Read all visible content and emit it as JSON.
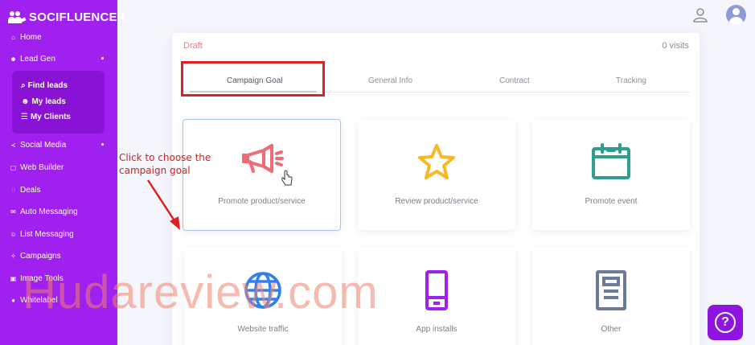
{
  "brand": {
    "name": "SOCIFLUENCER"
  },
  "sidebar": {
    "items": [
      {
        "label": "Home",
        "icon": "home-icon"
      },
      {
        "label": "Lead Gen",
        "icon": "users-icon"
      },
      {
        "label": "Social Media",
        "icon": "share-icon"
      },
      {
        "label": "Web Builder",
        "icon": "window-icon"
      },
      {
        "label": "Deals",
        "icon": "tag-icon"
      },
      {
        "label": "Auto Messaging",
        "icon": "mail-icon"
      },
      {
        "label": "List Messaging",
        "icon": "people-icon"
      },
      {
        "label": "Campaigns",
        "icon": "campaign-icon"
      },
      {
        "label": "Image Tools",
        "icon": "image-icon"
      },
      {
        "label": "Whitelabel",
        "icon": "whitelabel-icon"
      }
    ],
    "submenu": [
      {
        "label": "Find leads",
        "icon": "search-icon"
      },
      {
        "label": "My leads",
        "icon": "users-icon"
      },
      {
        "label": "My Clients",
        "icon": "list-icon"
      }
    ]
  },
  "campaign": {
    "status": "Draft",
    "visits": "0 visits",
    "tabs": [
      "Campaign Goal",
      "General Info",
      "Contract",
      "Tracking"
    ],
    "goals": [
      {
        "label": "Promote product/service",
        "icon": "megaphone-icon",
        "color": "#f36a73"
      },
      {
        "label": "Review product/service",
        "icon": "star-icon",
        "color": "#f7b928"
      },
      {
        "label": "Promote event",
        "icon": "calendar-icon",
        "color": "#2f9e8f"
      },
      {
        "label": "Website traffic",
        "icon": "globe-icon",
        "color": "#2f80ed"
      },
      {
        "label": "App installs",
        "icon": "phone-icon",
        "color": "#a020f0"
      },
      {
        "label": "Other",
        "icon": "document-icon",
        "color": "#6b7a99"
      }
    ]
  },
  "annotation": {
    "note_line1": "Click to choose the",
    "note_line2": "campaign goal"
  },
  "watermark": "Hudareview.com",
  "colors": {
    "sidebar": "#a020f0",
    "highlight": "#e02020"
  }
}
